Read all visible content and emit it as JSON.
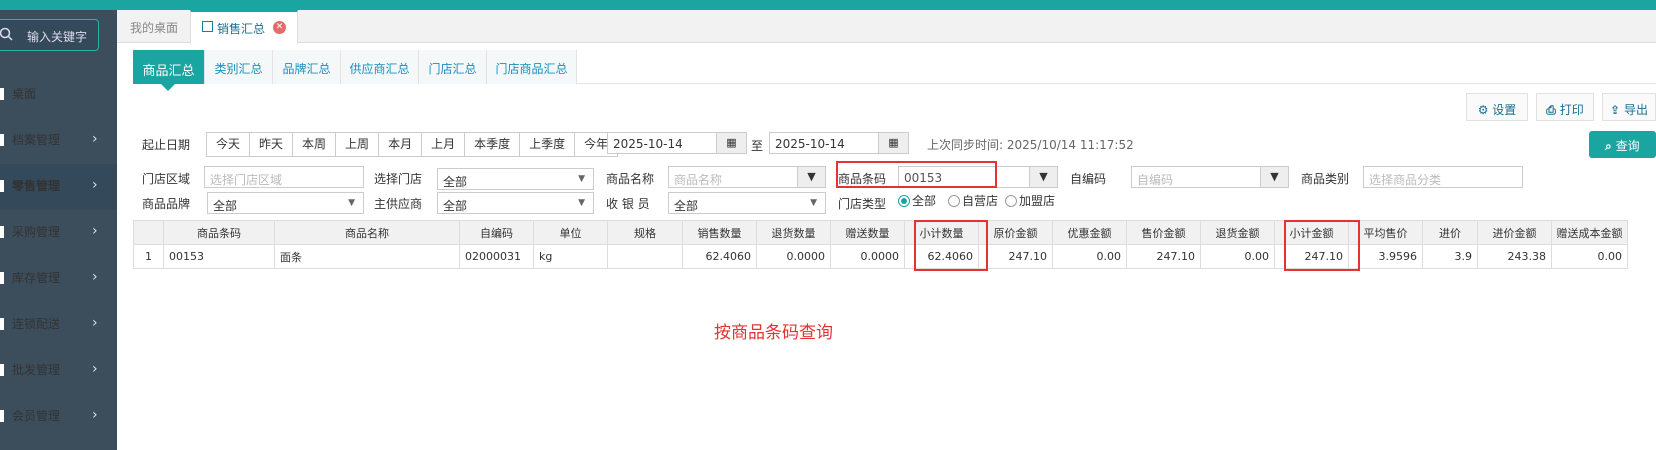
{
  "sidebar": {
    "search_placeholder": "输入关键字",
    "items": [
      {
        "label": "桌面",
        "has_arrow": false
      },
      {
        "label": "档案管理",
        "has_arrow": true
      },
      {
        "label": "零售管理",
        "has_arrow": true,
        "active": true
      },
      {
        "label": "采购管理",
        "has_arrow": true
      },
      {
        "label": "库存管理",
        "has_arrow": true
      },
      {
        "label": "连锁配送",
        "has_arrow": true
      },
      {
        "label": "批发管理",
        "has_arrow": true
      },
      {
        "label": "会员管理",
        "has_arrow": true
      }
    ]
  },
  "window_tabs": [
    {
      "label": "我的桌面"
    },
    {
      "label": "销售汇总",
      "active": true
    }
  ],
  "sub_tabs": [
    "商品汇总",
    "类别汇总",
    "品牌汇总",
    "供应商汇总",
    "门店汇总",
    "门店商品汇总"
  ],
  "actions": {
    "settings": "设置",
    "print": "打印",
    "export": "导出",
    "query": "查询"
  },
  "filters": {
    "date_range_label": "起止日期",
    "quick_dates": [
      "今天",
      "昨天",
      "本周",
      "上周",
      "本月",
      "上月",
      "本季度",
      "上季度",
      "今年"
    ],
    "start_date": "2025-10-14",
    "to_label": "至",
    "end_date": "2025-10-14",
    "last_sync": "上次同步时间: 2025/10/14 11:17:52",
    "store_area_label": "门店区域",
    "store_area_placeholder": "选择门店区域",
    "select_store_label": "选择门店",
    "select_store_value": "全部",
    "product_name_label": "商品名称",
    "product_name_placeholder": "商品名称",
    "barcode_label": "商品条码",
    "barcode_value": "00153",
    "self_code_label": "自编码",
    "self_code_placeholder": "自编码",
    "category_label": "商品类别",
    "category_placeholder": "选择商品分类",
    "brand_label": "商品品牌",
    "brand_value": "全部",
    "supplier_label": "主供应商",
    "supplier_value": "全部",
    "cashier_label": "收 银 员",
    "cashier_value": "全部",
    "store_type_label": "门店类型",
    "store_types": [
      "全部",
      "自营店",
      "加盟店"
    ]
  },
  "table": {
    "headers": [
      "",
      "商品条码",
      "商品名称",
      "自编码",
      "单位",
      "规格",
      "销售数量",
      "退货数量",
      "赠送数量",
      "小计数量",
      "原价金额",
      "优惠金额",
      "售价金额",
      "退货金额",
      "小计金额",
      "平均售价",
      "进价",
      "进价金额",
      "赠送成本金额"
    ],
    "rows": [
      [
        "1",
        "00153",
        "面条",
        "02000031",
        "kg",
        "",
        "62.4060",
        "0.0000",
        "0.0000",
        "62.4060",
        "247.10",
        "0.00",
        "247.10",
        "0.00",
        "247.10",
        "3.9596",
        "3.9",
        "243.38",
        "0.00"
      ]
    ]
  },
  "annotation": "按商品条码查询"
}
